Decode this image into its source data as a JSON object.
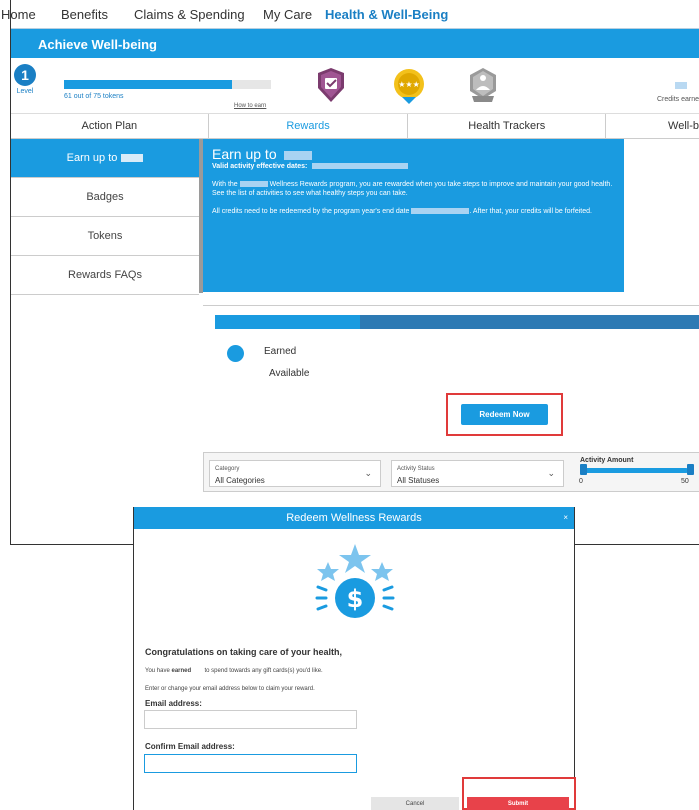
{
  "topnav": {
    "items": [
      "Home",
      "Benefits",
      "Claims & Spending",
      "My Care",
      "Health & Well-Being"
    ],
    "active": "Health & Well-Being"
  },
  "banner": {
    "title": "Achieve Well-being"
  },
  "level": {
    "number": "1",
    "label": "Level",
    "progress_text": "61 out of 75 tokens",
    "progress_fraction": 0.813,
    "how_to_earn": "How to earn",
    "credits_label": "Credits earne",
    "badges": [
      "shield-badge-icon",
      "star-medal-icon",
      "meditation-badge-icon"
    ]
  },
  "tabs": [
    "Action Plan",
    "Rewards",
    "Health Trackers",
    "Well-b"
  ],
  "sidebar": {
    "items": [
      {
        "label": "Earn up to",
        "active": true
      },
      {
        "label": "Badges",
        "active": false
      },
      {
        "label": "Tokens",
        "active": false
      },
      {
        "label": "Rewards FAQs",
        "active": false
      }
    ]
  },
  "panel": {
    "title": "Earn up to",
    "valid_dates_label": "Valid activity effective dates:",
    "p1_prefix": "With the",
    "p1_rest": "Wellness Rewards program, you are rewarded when you take steps to improve and maintain your good health.  See the list of activities to see what healthy steps you can take.",
    "p2_prefix": "All credits need to be redeemed by the program year's end date",
    "p2_rest": ". After that, your credits will be forfeited."
  },
  "earn": {
    "earned_label": "Earned",
    "available_label": "Available",
    "redeem_button": "Redeem Now"
  },
  "filters": {
    "category": {
      "label": "Category",
      "value": "All Categories"
    },
    "status": {
      "label": "Activity Status",
      "value": "All Statuses"
    },
    "amount": {
      "title": "Activity Amount",
      "min": "0",
      "max": "50"
    }
  },
  "modal": {
    "title": "Redeem Wellness Rewards",
    "close": "×",
    "congrats": "Congratulations on taking care of your health,",
    "line1_prefix": "You have",
    "line1_bold": "earned",
    "line1_rest": "to spend towards any gift cards(s) you'd like.",
    "line2": "Enter or change your email address below to claim your reward.",
    "email_label": "Email address:",
    "confirm_label": "Confirm Email address:",
    "cancel": "Cancel",
    "submit": "Submit"
  },
  "colors": {
    "brand_blue": "#1a9be0",
    "dark_blue": "#2d7ab4",
    "highlight_red": "#e03a3a",
    "submit_red": "#e8424a"
  }
}
